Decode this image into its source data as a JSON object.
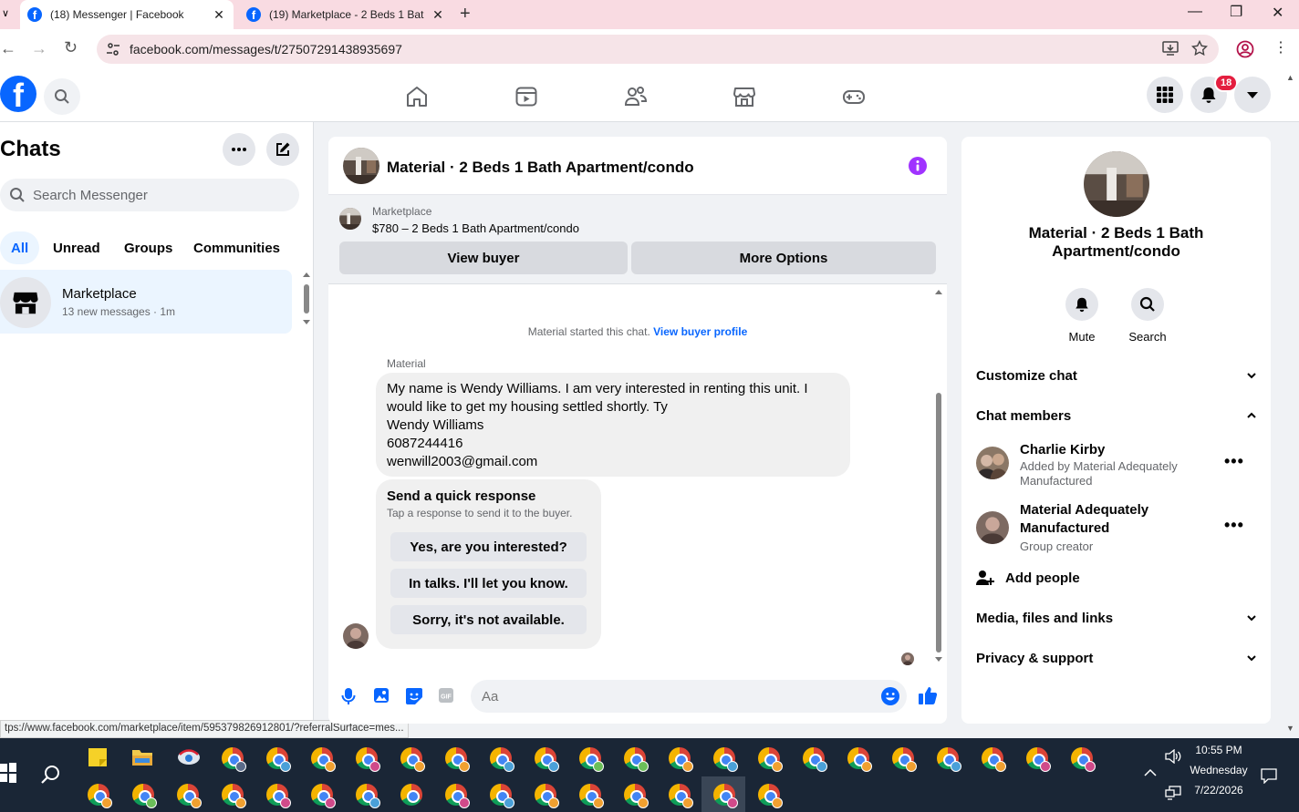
{
  "browser": {
    "tabs": [
      {
        "title": "(18) Messenger | Facebook",
        "active": true
      },
      {
        "title": "(19) Marketplace - 2 Beds 1 Bat",
        "active": false
      }
    ],
    "url": "facebook.com/messages/t/27507291438935697",
    "status_url": "tps://www.facebook.com/marketplace/item/595379826912801/?referralSurface=mes..."
  },
  "header": {
    "notification_count": "18"
  },
  "sidebar": {
    "title": "Chats",
    "search_placeholder": "Search Messenger",
    "filters": [
      "All",
      "Unread",
      "Groups",
      "Communities"
    ],
    "chats": [
      {
        "name": "Marketplace",
        "subtitle": "13 new messages · 1m"
      }
    ]
  },
  "conversation": {
    "title": "Material · 2 Beds 1 Bath Apartment/condo",
    "marketplace": {
      "label": "Marketplace",
      "listing": "$780 – 2 Beds 1 Bath Apartment/condo",
      "view_buyer": "View buyer",
      "more_options": "More Options"
    },
    "started_text": "Material started this chat.",
    "started_link": "View buyer profile",
    "sender": "Material",
    "message_lines": [
      "My name is Wendy Williams. I am very interested in renting this unit. I",
      "would like to get my housing settled shortly. Ty",
      "Wendy Williams",
      "6087244416",
      "wenwill2003@gmail.com"
    ],
    "quick_response": {
      "title": "Send a quick response",
      "subtitle": "Tap a response to send it to the buyer.",
      "options": [
        "Yes, are you interested?",
        "In talks. I'll let you know.",
        "Sorry, it's not available."
      ]
    },
    "composer_placeholder": "Aa"
  },
  "info_panel": {
    "title": "Material · 2 Beds 1 Bath Apartment/condo",
    "actions": [
      "Mute",
      "Search"
    ],
    "sections": {
      "customize": "Customize chat",
      "members": "Chat members",
      "add_people": "Add people",
      "media": "Media, files and links",
      "privacy": "Privacy & support"
    },
    "members": [
      {
        "name": "Charlie Kirby",
        "detail": "Added by Material Adequately Manufactured"
      },
      {
        "name": "Material Adequately Manufactured",
        "detail": "Group creator"
      }
    ]
  },
  "taskbar": {
    "time": "10:55 PM",
    "day": "Wednesday",
    "date": "7/22/2026"
  },
  "colors": {
    "fb_blue": "#0866ff",
    "tab_strip": "#f9dbe2",
    "notification_red": "#e41e3f",
    "info_purple": "#a033ff"
  }
}
